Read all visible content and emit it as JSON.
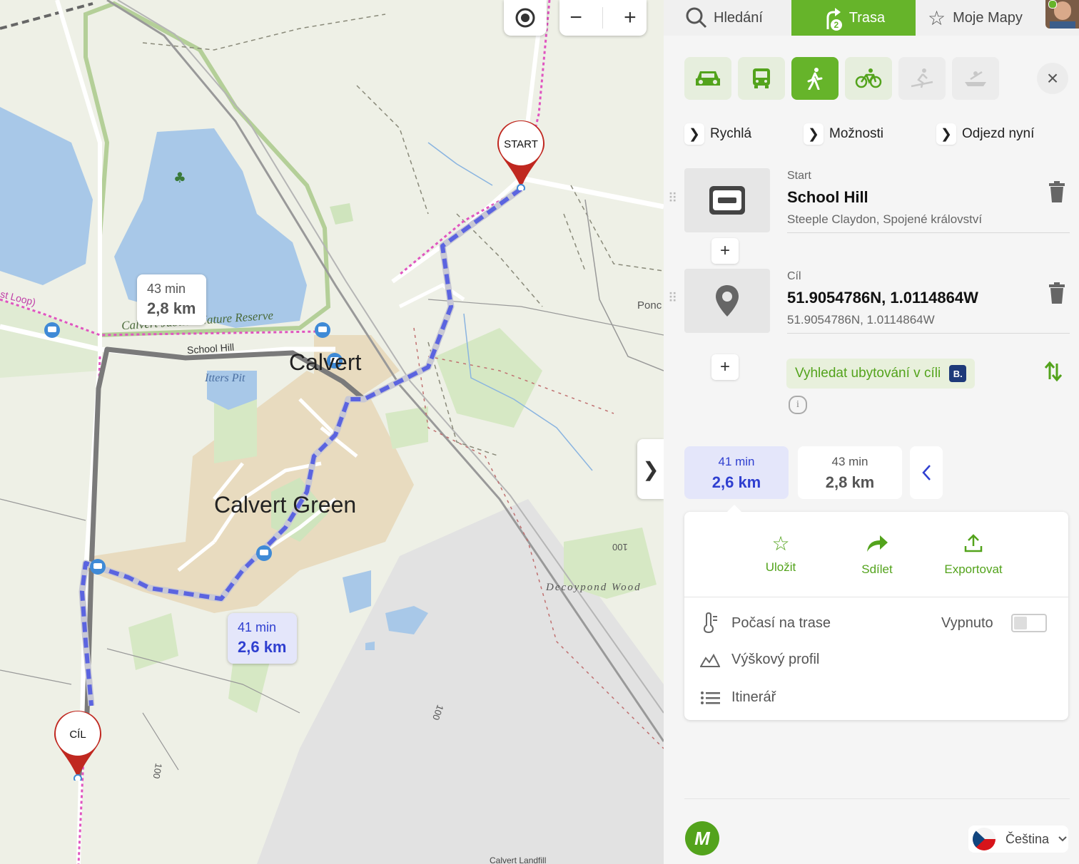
{
  "map": {
    "start_pin_label": "START",
    "end_pin_label": "CÍL",
    "route_alt": {
      "time": "43 min",
      "distance": "2,8 km"
    },
    "route_main": {
      "time": "41 min",
      "distance": "2,6 km"
    },
    "places": {
      "calvert": "Calvert",
      "calvert_green": "Calvert Green",
      "school_hill": "School Hill",
      "itters_pit": "Itters Pit",
      "nature_reserve": "Calvert Jubilee Nature Reserve",
      "decoypond_wood": "Decoypond Wood",
      "pond": "Ponc",
      "loop": "st Loop)",
      "landfill": "Calvert Landfill",
      "contour_100_a": "100",
      "contour_100_b": "100",
      "contour_100_c": "100"
    },
    "zoom_out": "−",
    "zoom_in": "+",
    "collapse": "❯"
  },
  "panel": {
    "tabs": {
      "search": "Hledání",
      "route": "Trasa",
      "my_maps": "Moje Mapy"
    },
    "route_tab_badge": "2",
    "options": {
      "fast": "Rychlá",
      "options": "Možnosti",
      "depart": "Odjezd nyní"
    },
    "start": {
      "label": "Start",
      "name": "School Hill",
      "sub": "Steeple Claydon, Spojené království"
    },
    "end": {
      "label": "Cíl",
      "name": "51.9054786N, 1.0114864W",
      "sub": "51.9054786N, 1.0114864W"
    },
    "add_waypoint": "+",
    "booking": {
      "label": "Vyhledat ubytování v cíli",
      "badge": "B."
    },
    "alternatives": [
      {
        "time": "41 min",
        "distance": "2,6 km"
      },
      {
        "time": "43 min",
        "distance": "2,8 km"
      }
    ],
    "actions": {
      "save": "Uložit",
      "share": "Sdílet",
      "export": "Exportovat"
    },
    "weather": {
      "label": "Počasí na trase",
      "state": "Vypnuto"
    },
    "elevation": "Výškový profil",
    "itinerary": "Itinerář",
    "language": "Čeština",
    "logo": "M",
    "close": "×",
    "info": "i"
  }
}
